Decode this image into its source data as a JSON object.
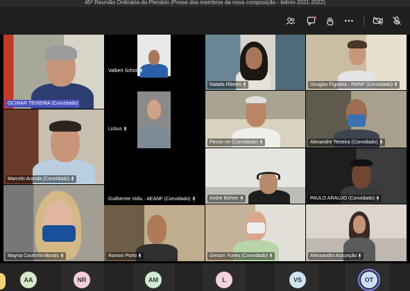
{
  "meeting": {
    "title": "45ª Reunião Ordinária do Plenário (Posse dos membros da nova composição - biênio 2021-2022)"
  },
  "toolbar": {
    "icons": [
      "people-icon",
      "chat-icon",
      "raise-hand-icon",
      "more-icon",
      "camera-off-icon",
      "mic-off-icon"
    ]
  },
  "participants": [
    {
      "name": "OCIMAR TEIXEIRA (Convidado)",
      "highlight": true
    },
    {
      "name": "Valbert Schott"
    },
    {
      "name": "Lickus"
    },
    {
      "name": "Natalia Ribeiro"
    },
    {
      "name": "Douglas Figueira - PMNF (Convidado)"
    },
    {
      "name": "Percio ort (Convidado)"
    },
    {
      "name": "Alexandre Teixeira (Convidado)"
    },
    {
      "name": "Marcelo Aranda (Convidado)"
    },
    {
      "name": "Guilherme Vollu - AEANF (Convidado)"
    },
    {
      "name": "Andre Bohrer"
    },
    {
      "name": "PAULO ARAUJO (Convidado)"
    },
    {
      "name": "Mayna Coutinho Morais"
    },
    {
      "name": "Ramon Porto"
    },
    {
      "name": "Gerson Yunes (Convidado)"
    },
    {
      "name": "Alessandra Assunção"
    }
  ],
  "avatars": [
    {
      "initials": "AA",
      "color": "#d6e8c8"
    },
    {
      "initials": "NR",
      "color": "#f5d0da"
    },
    {
      "initials": "AM",
      "color": "#cfe9d3"
    },
    {
      "initials": "L",
      "color": "#f7d1de"
    },
    {
      "initials": "VS",
      "color": "#cfe6f2"
    },
    {
      "initials": "OT",
      "color": "#c9e0f5"
    }
  ],
  "colors": {
    "accent": "#7f85f5",
    "highlight_name": "#4b53bc"
  }
}
